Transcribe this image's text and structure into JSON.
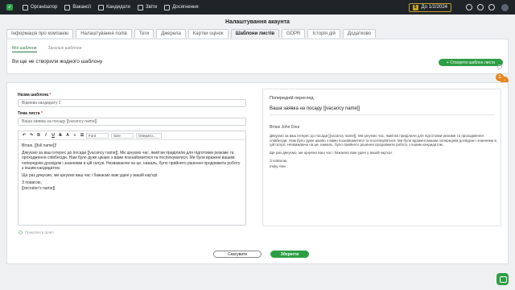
{
  "nav": {
    "items": [
      {
        "label": "Організатор",
        "icon": "organizer-icon"
      },
      {
        "label": "Вакансії",
        "icon": "briefcase-icon"
      },
      {
        "label": "Кандидати",
        "icon": "people-icon"
      },
      {
        "label": "Звіти",
        "icon": "chart-icon"
      },
      {
        "label": "Досягнення",
        "icon": "trophy-icon"
      }
    ],
    "date_chip": "До 1/2/2024",
    "brand_color": "#2fa84f"
  },
  "page_title": "Налаштування акаунта",
  "tabs": [
    {
      "label": "Інформація про компанію",
      "active": false
    },
    {
      "label": "Налаштування полів",
      "active": false
    },
    {
      "label": "Теги",
      "active": false
    },
    {
      "label": "Джерела",
      "active": false
    },
    {
      "label": "Картки оцінок",
      "active": false
    },
    {
      "label": "Шаблони листів",
      "active": true
    },
    {
      "label": "GDPR",
      "active": false
    },
    {
      "label": "Історія дій",
      "active": false
    },
    {
      "label": "Додатково",
      "active": false
    }
  ],
  "subtabs": {
    "mine": "Мої шаблони",
    "shared": "Загальні шаблони"
  },
  "empty_text": "Ви ще не створили жодного шаблону",
  "create_button": "+ Створити шаблон листа",
  "form": {
    "name_label": "Назва шаблона",
    "name_value": "Відмова кандидату 2",
    "subject_label": "Тема листа",
    "subject_value": "Вашa заявка на посаду [[vacancy name]]",
    "toolbar": {
      "font": "Font",
      "size": "Size",
      "para": "Операто..."
    },
    "body": {
      "greeting": "Вітаю, [[full name]]!",
      "p1": "Дякуємо за ваш інтерес до посади [[vacancy name]]. Ми цінуємо час, який ви приділили для підготовки резюме та проходження співбесіди. Нам було дуже цікаво з вами познайомитися та поспілкуватися. Ми були вражені вашим попереднім досвідом і знаннями в цій галузі. Незважаючи на це, нажаль, було прийнято рішення продовжити роботу з іншим кандидатом.",
      "p2": "Ще раз дякуємо, ми цінуємо ваш час і бажаємо вам удачі у вашій кар'єрі.",
      "closing": "З повагою,",
      "signature": "[[recruiter's name]]"
    },
    "attach_label": "Прикріпити файл"
  },
  "preview": {
    "title": "Попередній перегляд",
    "subject": "Вашa заявка на посаду [[vacancy name]]",
    "greeting": "Вітаю John Dour",
    "p1": "Дякуємо за ваш інтерес до посади [[vacancy name]]. Ми цінуємо час, який ви приділили для підготовки резюме та проходження співбесіди. Нам було дуже цікаво з вами познайомитися та поспілкуватися. Ми були вражені вашим попереднім досвідом і знаннями в цій галузі. Незважаючи на це, нажаль, було прийнято рішення продовжити роботу з іншим кандидатом.",
    "p2": "Ще раз дякуємо, ми цінуємо ваш час і бажаємо вам удачі у вашій кар'єрі.",
    "closing": "З повагою,",
    "signature": "Insky Alex"
  },
  "buttons": {
    "cancel": "Скасувати",
    "save": "Зберегти"
  },
  "notif_count": "1"
}
